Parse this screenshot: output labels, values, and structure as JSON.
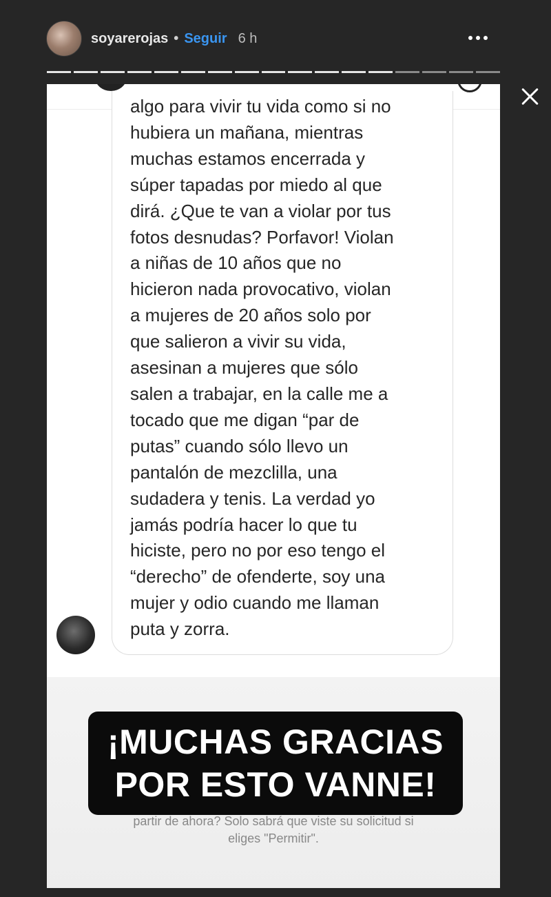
{
  "header": {
    "username": "soyarerojas",
    "separator": "•",
    "follow_label": "Seguir",
    "time": "6 h",
    "avatar_icon": "profile-avatar",
    "more_icon": "more-horizontal-icon",
    "close_icon": "close-icon",
    "progress": {
      "segments_total": 17,
      "segments_viewed": 13
    },
    "colors": {
      "follow": "#3a95f0",
      "background": "#262626"
    }
  },
  "message": {
    "lines": [
      "algo para vivir tu vida como si no",
      "hubiera un mañana, mientras",
      "muchas estamos encerrada y",
      "súper tapadas por miedo al que",
      "dirá. ¿Que te van a violar por tus",
      "fotos desnudas? Porfavor! Violan",
      "a niñas de 10 años que no",
      "hicieron nada provocativo, violan",
      "a mujeres de 20 años solo por",
      "que salieron a vivir su vida,",
      "asesinan a mujeres que sólo",
      "salen a trabajar, en la calle me a",
      "tocado que me digan “par de",
      "putas” cuando sólo llevo un",
      "pantalón de mezclilla, una",
      "sudadera y tenis. La verdad yo",
      "jamás podría hacer lo que tu",
      "hiciste, pero no por eso tengo el",
      "“derecho” de ofenderte, soy una",
      "mujer y odio cuando me llaman",
      "puta y zorra."
    ]
  },
  "request_notice": {
    "line1": "partir de ahora? Solo sabrá que viste su solicitud si",
    "line2": "eliges \"Permitir\"."
  },
  "caption": {
    "line1": "¡MUCHAS GRACIAS",
    "line2": "POR ESTO VANNE!"
  }
}
